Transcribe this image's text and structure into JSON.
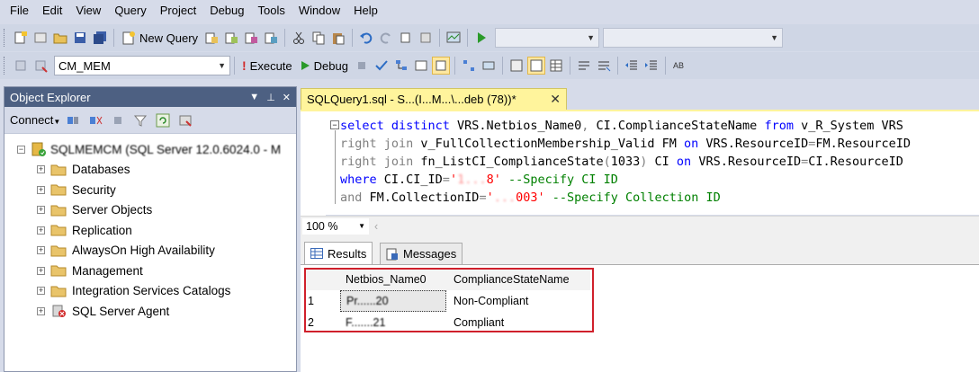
{
  "menu": [
    "File",
    "Edit",
    "View",
    "Query",
    "Project",
    "Debug",
    "Tools",
    "Window",
    "Help"
  ],
  "toolbar": {
    "new_query": "New Query",
    "database": "CM_MEM",
    "execute": "Execute",
    "debug": "Debug"
  },
  "object_explorer": {
    "title": "Object Explorer",
    "connect": "Connect",
    "server": "SQLMEMCM (SQL Server 12.0.6024.0 - M",
    "nodes": [
      {
        "label": "Databases",
        "icon": "folder"
      },
      {
        "label": "Security",
        "icon": "folder"
      },
      {
        "label": "Server Objects",
        "icon": "folder"
      },
      {
        "label": "Replication",
        "icon": "folder"
      },
      {
        "label": "AlwaysOn High Availability",
        "icon": "folder"
      },
      {
        "label": "Management",
        "icon": "folder"
      },
      {
        "label": "Integration Services Catalogs",
        "icon": "folder"
      },
      {
        "label": "SQL Server Agent",
        "icon": "sql-agent"
      }
    ]
  },
  "query_tab": {
    "title": "SQLQuery1.sql - S...(I...M...\\...deb (78))*"
  },
  "editor": {
    "lines": [
      "select distinct VRS.Netbios_Name0, CI.ComplianceStateName from v_R_System VRS",
      "right join v_FullCollectionMembership_Valid FM on VRS.ResourceID=FM.ResourceID",
      "right join fn_ListCI_ComplianceState(1033) CI on VRS.ResourceID=CI.ResourceID",
      "where CI.CI_ID='1...8' --Specify CI ID",
      "and FM.CollectionID='...003' --Specify Collection ID"
    ]
  },
  "zoom": "100 %",
  "result_tabs": [
    "Results",
    "Messages"
  ],
  "results": {
    "columns": [
      "Netbios_Name0",
      "ComplianceStateName"
    ],
    "rows": [
      {
        "n": "1",
        "name": "Pr......20",
        "state": "Non-Compliant"
      },
      {
        "n": "2",
        "name": "F.......21",
        "state": "Compliant"
      }
    ]
  },
  "colors": {
    "title_bar": "#4d6082",
    "tab_active": "#fff49c",
    "highlight_box": "#d0202b",
    "keyword": "#0000ff",
    "string": "#ff0000",
    "comment": "#008000"
  }
}
